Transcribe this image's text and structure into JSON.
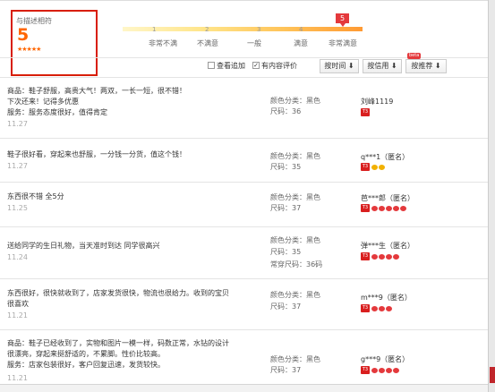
{
  "summary": {
    "title": "与描述相符",
    "score": "5",
    "stars": "★★★★★",
    "scale_numbers": [
      "1",
      "2",
      "3",
      "4"
    ],
    "scale_marker": "5",
    "scale_labels": [
      "非常不满",
      "不满意",
      "一般",
      "满意",
      "非常满意"
    ]
  },
  "toolbar": {
    "filter_additional": "查看追加",
    "filter_has_content": "有内容评价",
    "has_content_checked": "✓",
    "sort_time": "按时间 ⬇",
    "sort_credit": "按信用 ⬇",
    "sort_recommend": "按推荐 ⬇",
    "beta_badge": "beta"
  },
  "reviews": [
    {
      "lines": [
        "商品：鞋子舒服，高贵大气！两双，一长一短，很不错！",
        "下次还来！记得多优惠",
        "服务：服务态度很好，值得肯定"
      ],
      "date": "11.27",
      "color": "颜色分类：黑色",
      "size": "尺码：36",
      "extra": "",
      "user": "刘峰1119",
      "level_badge": "T3",
      "level_marks": 0,
      "level_gold": 0
    },
    {
      "lines": [
        "鞋子很好看，穿起来也舒服，一分钱一分货，值这个钱！"
      ],
      "date": "11.27",
      "color": "颜色分类：黑色",
      "size": "尺码：35",
      "extra": "",
      "user": "q***1（匿名）",
      "level_badge": "T3",
      "level_marks": 0,
      "level_gold": 2
    },
    {
      "lines": [
        "东西很不错 全5分"
      ],
      "date": "11.25",
      "color": "颜色分类：黑色",
      "size": "尺码：37",
      "extra": "",
      "user": "芭***郎（匿名）",
      "level_badge": "T3",
      "level_marks": 5,
      "level_gold": 0
    },
    {
      "lines": [
        "送给同学的生日礼物，当天准时到达 同学很高兴"
      ],
      "date": "11.24",
      "color": "颜色分类：黑色",
      "size": "尺码：35",
      "extra": "常穿尺码：36码",
      "user": "弹***生（匿名）",
      "level_badge": "T3",
      "level_marks": 4,
      "level_gold": 0
    },
    {
      "lines": [
        "东西很好，很快就收到了，店家发货很快，物流也很给力。收到的宝贝",
        "很喜欢"
      ],
      "date": "11.21",
      "color": "颜色分类：黑色",
      "size": "尺码：37",
      "extra": "",
      "user": "m***9（匿名）",
      "level_badge": "T3",
      "level_marks": 3,
      "level_gold": 0
    },
    {
      "lines": [
        "商品：鞋子已经收到了，实物和图片一模一样，码数正常，水钻的设计",
        "很漂亮，穿起来挺舒适的，不累脚。性价比较高。",
        "服务：店家包装很好，客户回复迅速，发货较快。"
      ],
      "date": "11.21",
      "color": "颜色分类：黑色",
      "size": "尺码：37",
      "extra": "",
      "user": "g***9（匿名）",
      "level_badge": "T3",
      "level_marks": 4,
      "level_gold": 0
    }
  ]
}
